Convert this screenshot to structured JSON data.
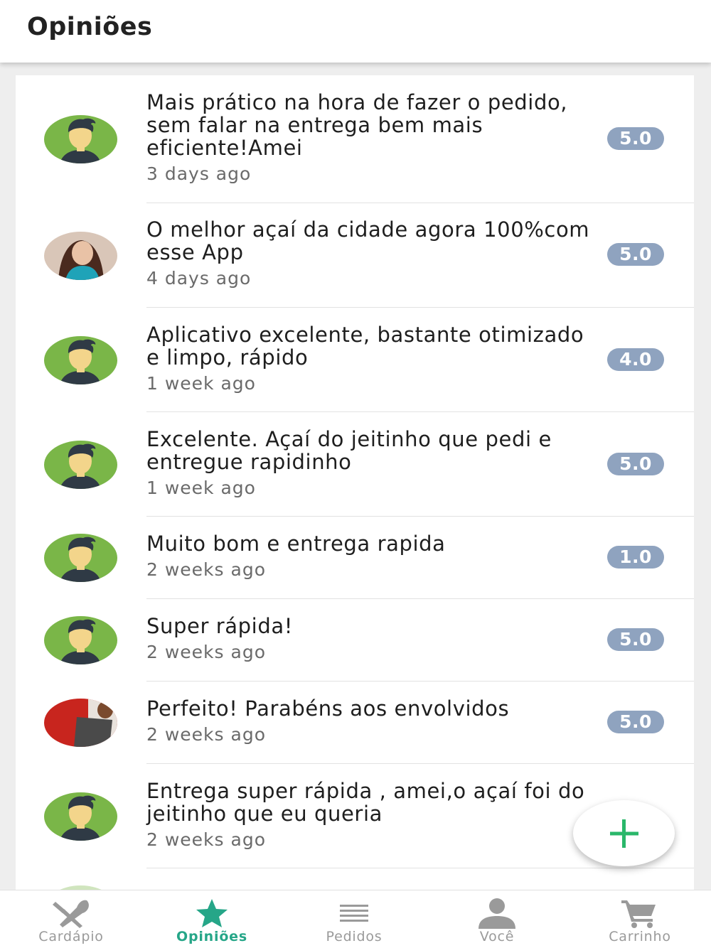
{
  "header": {
    "title": "Opiniões"
  },
  "reviews": [
    {
      "text": "Mais prático na hora de fazer o pedido, sem falar na entrega bem mais eficiente!Amei",
      "time": "3 days ago",
      "rating": "5.0",
      "avatar": "default-avatar"
    },
    {
      "text": "O melhor açaí da cidade agora 100%com esse App",
      "time": "4 days ago",
      "rating": "5.0",
      "avatar": "user-photo"
    },
    {
      "text": "Aplicativo excelente, bastante otimizado e limpo, rápido",
      "time": "1 week ago",
      "rating": "4.0",
      "avatar": "default-avatar"
    },
    {
      "text": "Excelente. Açaí do jeitinho que pedi e entregue rapidinho",
      "time": "1 week ago",
      "rating": "5.0",
      "avatar": "default-avatar"
    },
    {
      "text": "Muito bom e entrega rapida",
      "time": "2 weeks ago",
      "rating": "1.0",
      "avatar": "default-avatar"
    },
    {
      "text": "Super rápida!",
      "time": "2 weeks ago",
      "rating": "5.0",
      "avatar": "default-avatar"
    },
    {
      "text": "Perfeito! Parabéns aos envolvidos",
      "time": "2 weeks ago",
      "rating": "5.0",
      "avatar": "user-photo"
    },
    {
      "text": "Entrega super rápida , amei,o açaí foi do jeitinho que eu queria",
      "time": "2 weeks ago",
      "rating": "",
      "avatar": "default-avatar"
    }
  ],
  "fab": {
    "icon": "plus-icon",
    "color": "#2ab76a"
  },
  "nav": [
    {
      "label": "Cardápio",
      "icon": "utensils-icon",
      "active": false
    },
    {
      "label": "Opiniões",
      "icon": "star-icon",
      "active": true
    },
    {
      "label": "Pedidos",
      "icon": "list-icon",
      "active": false
    },
    {
      "label": "Você",
      "icon": "person-icon",
      "active": false
    },
    {
      "label": "Carrinho",
      "icon": "cart-icon",
      "active": false
    }
  ],
  "colors": {
    "accent": "#26a688",
    "rating_badge": "#8fa3bf",
    "avatar_green": "#7ab648"
  }
}
